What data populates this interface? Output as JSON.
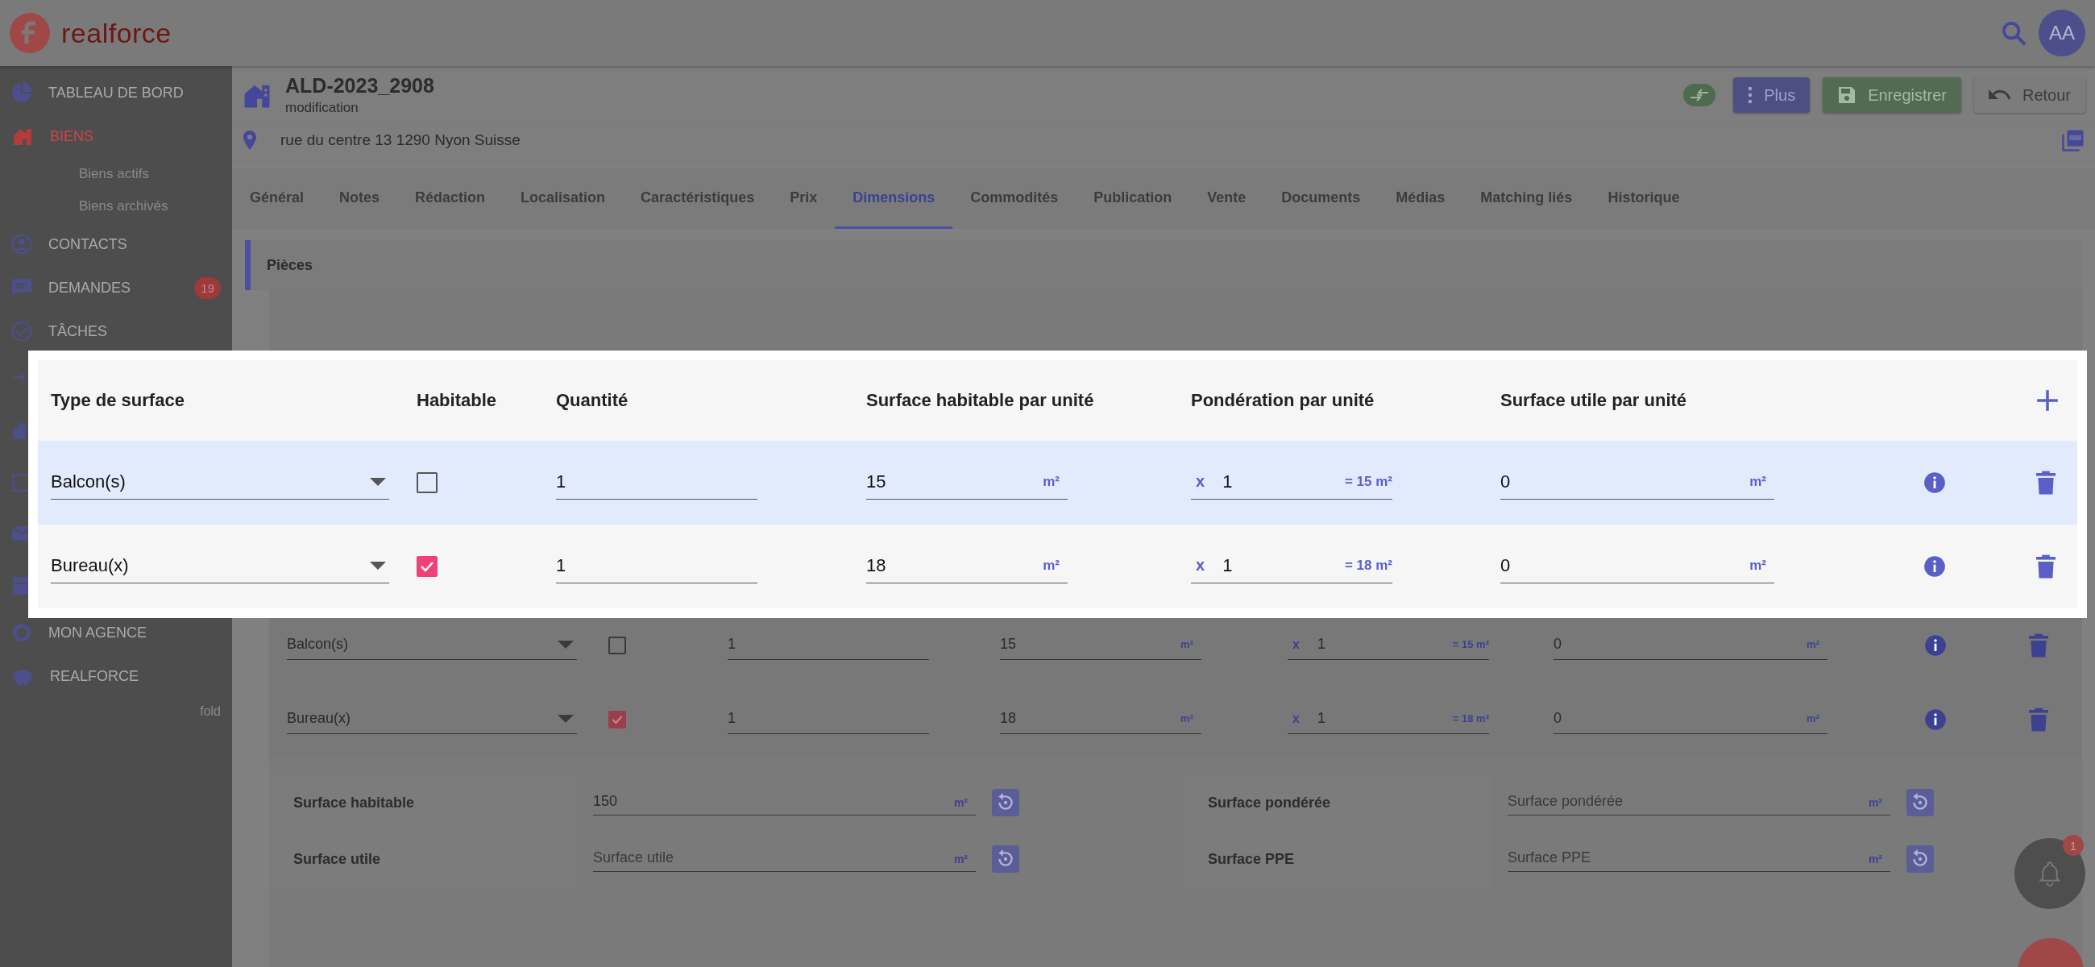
{
  "app": {
    "brand": "realforce",
    "avatar": "AA"
  },
  "sidebar": {
    "items": [
      {
        "kind": "main",
        "label": "TABLEAU DE BORD",
        "selected": false
      },
      {
        "kind": "main",
        "label": "BIENS",
        "selected": true
      },
      {
        "kind": "sub",
        "label": "Biens actifs",
        "selected": false
      },
      {
        "kind": "sub",
        "label": "Biens archivés",
        "selected": false
      },
      {
        "kind": "main",
        "label": "CONTACTS",
        "selected": false
      },
      {
        "kind": "main",
        "label": "DEMANDES",
        "selected": false,
        "badge": "19"
      },
      {
        "kind": "main",
        "label": "TÂCHES",
        "selected": false
      },
      {
        "kind": "covered"
      },
      {
        "kind": "covered"
      },
      {
        "kind": "covered"
      },
      {
        "kind": "covered"
      },
      {
        "kind": "covered"
      },
      {
        "kind": "main",
        "label": "MON AGENCE",
        "selected": false
      },
      {
        "kind": "main",
        "label": "REALFORCE",
        "selected": false
      }
    ],
    "fold": "fold"
  },
  "header": {
    "title": "ALD-2023_2908",
    "subtitle": "modification",
    "address": "rue du centre 13 1290 Nyon Suisse",
    "buttons": [
      {
        "kind": "toggle"
      },
      {
        "kind": "menu",
        "label": "Plus"
      },
      {
        "kind": "save",
        "label": "Enregistrer"
      },
      {
        "kind": "back",
        "label": "Retour"
      }
    ]
  },
  "tabs": [
    {
      "label": "Général",
      "selected": false
    },
    {
      "label": "Notes",
      "selected": false
    },
    {
      "label": "Rédaction",
      "selected": false
    },
    {
      "label": "Localisation",
      "selected": false
    },
    {
      "label": "Caractéristiques",
      "selected": false
    },
    {
      "label": "Prix",
      "selected": false
    },
    {
      "label": "Dimensions",
      "selected": true
    },
    {
      "label": "Commodités",
      "selected": false
    },
    {
      "label": "Publication",
      "selected": false
    },
    {
      "label": "Vente",
      "selected": false
    },
    {
      "label": "Documents",
      "selected": false
    },
    {
      "label": "Médias",
      "selected": false
    },
    {
      "label": "Matching liés",
      "selected": false
    },
    {
      "label": "Historique",
      "selected": false
    }
  ],
  "section": {
    "title": "Pièces"
  },
  "rooms": {
    "rows": [
      {
        "type": "Balcon(s)",
        "habitable": false,
        "quantity": "1",
        "surface": "15",
        "surface_unit": "m²",
        "weight_prefix": "x",
        "weight": "1",
        "weight_result": "= 15 m²",
        "useful": "0",
        "useful_unit": "m²"
      },
      {
        "type": "Bureau(x)",
        "habitable": true,
        "quantity": "1",
        "surface": "18",
        "surface_unit": "m²",
        "weight_prefix": "x",
        "weight": "1",
        "weight_result": "= 18 m²",
        "useful": "0",
        "useful_unit": "m²"
      }
    ]
  },
  "summary": {
    "fields": [
      {
        "label": "Surface habitable",
        "value": "150",
        "unit": "m²"
      },
      {
        "label": "Surface pondérée",
        "placeholder": "Surface pondérée",
        "unit": "m²"
      },
      {
        "label": "Surface utile",
        "placeholder": "Surface utile",
        "unit": "m²"
      },
      {
        "label": "Surface PPE",
        "placeholder": "Surface PPE",
        "unit": "m²"
      }
    ]
  },
  "notifications": {
    "badge": "1"
  },
  "highlight": {
    "columns": [
      "Type de surface",
      "Habitable",
      "Quantité",
      "Surface habitable par unité",
      "Pondération par unité",
      "Surface utile par unité"
    ],
    "rows": [
      {
        "type": "Balcon(s)",
        "habitable": false,
        "selected": true,
        "quantity": "1",
        "surface": "15",
        "surface_unit": "m²",
        "weight_prefix": "x",
        "weight": "1",
        "weight_result": "= 15 m²",
        "useful": "0",
        "useful_unit": "m²"
      },
      {
        "type": "Bureau(x)",
        "habitable": true,
        "selected": false,
        "quantity": "1",
        "surface": "18",
        "surface_unit": "m²",
        "weight_prefix": "x",
        "weight": "1",
        "weight_result": "= 18 m²",
        "useful": "0",
        "useful_unit": "m²"
      }
    ]
  }
}
